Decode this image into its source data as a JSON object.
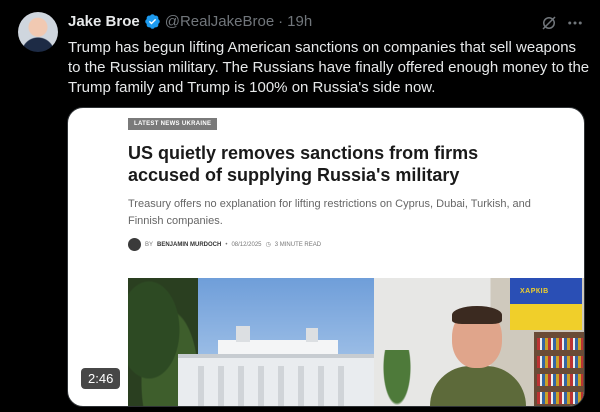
{
  "author": {
    "name": "Jake Broe",
    "handle": "@RealJakeBroe",
    "separator": "·",
    "time": "19h",
    "verified_color": "#1d9bf0"
  },
  "icons": {
    "grok": "grok-icon",
    "more": "more-icon",
    "verified": "verified-badge-icon"
  },
  "tweet": {
    "text": "Trump has begun lifting American sanctions on companies that sell weapons to the Russian military.  The Russians have finally offered enough money to the Trump family and Trump is 100% on Russia's side now."
  },
  "article": {
    "tag": "LATEST NEWS UKRAINE",
    "headline": "US quietly removes sanctions from firms accused of supplying Russia's military",
    "subhead": "Treasury offers no explanation for lifting restrictions on Cyprus, Dubai, Turkish, and Finnish companies.",
    "byline_prefix": "BY",
    "author": "BENJAMIN MURDOCH",
    "date": "08/12/2025",
    "read_time": "3 MINUTE READ"
  },
  "video": {
    "duration": "2:46",
    "flag_text": "ХАРКІВ"
  }
}
